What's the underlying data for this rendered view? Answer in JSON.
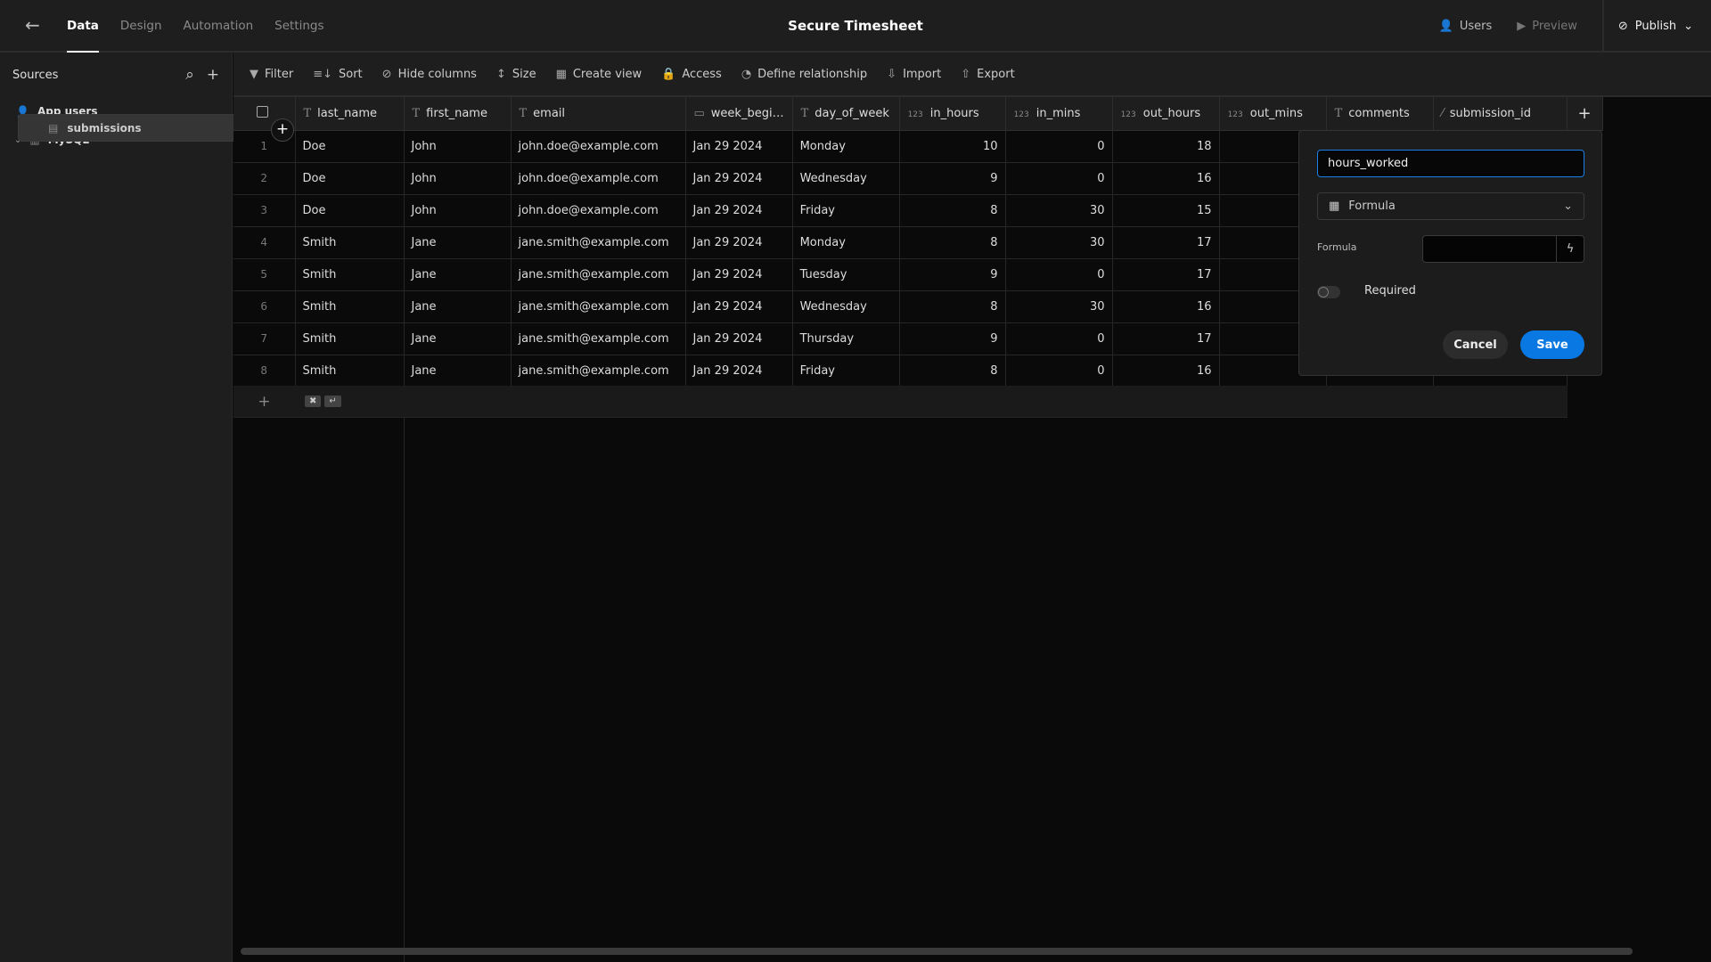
{
  "topbar": {
    "tabs": [
      "Data",
      "Design",
      "Automation",
      "Settings"
    ],
    "active_tab": "Data",
    "title": "Secure Timesheet",
    "users": "Users",
    "preview": "Preview",
    "publish": "Publish"
  },
  "sidebar": {
    "heading": "Sources",
    "items": [
      {
        "label": "App users",
        "icon": "users-icon"
      },
      {
        "label": "MySQL",
        "icon": "database-icon"
      },
      {
        "label": "submissions",
        "icon": "table-icon",
        "selected": true
      }
    ]
  },
  "toolbar": {
    "items": [
      {
        "label": "Filter",
        "icon": "▼"
      },
      {
        "label": "Sort",
        "icon": "≡↓"
      },
      {
        "label": "Hide columns",
        "icon": "⊘"
      },
      {
        "label": "Size",
        "icon": "↕"
      },
      {
        "label": "Create view",
        "icon": "▦"
      },
      {
        "label": "Access",
        "icon": "🔒"
      },
      {
        "label": "Define relationship",
        "icon": "◔"
      },
      {
        "label": "Import",
        "icon": "⇩"
      },
      {
        "label": "Export",
        "icon": "⇧"
      }
    ]
  },
  "table": {
    "columns": [
      {
        "name": "last_name",
        "type": "T"
      },
      {
        "name": "first_name",
        "type": "T"
      },
      {
        "name": "email",
        "type": "T"
      },
      {
        "name": "week_begi…",
        "type": "date"
      },
      {
        "name": "day_of_week",
        "type": "T"
      },
      {
        "name": "in_hours",
        "type": "123"
      },
      {
        "name": "in_mins",
        "type": "123"
      },
      {
        "name": "out_hours",
        "type": "123"
      },
      {
        "name": "out_mins",
        "type": "123"
      },
      {
        "name": "comments",
        "type": "T"
      },
      {
        "name": "submission_id",
        "type": "auto"
      }
    ],
    "rows": [
      [
        "1",
        "Doe",
        "John",
        "john.doe@example.com",
        "Jan 29 2024",
        "Monday",
        "10",
        "0",
        "18"
      ],
      [
        "2",
        "Doe",
        "John",
        "john.doe@example.com",
        "Jan 29 2024",
        "Wednesday",
        "9",
        "0",
        "16"
      ],
      [
        "3",
        "Doe",
        "John",
        "john.doe@example.com",
        "Jan 29 2024",
        "Friday",
        "8",
        "30",
        "15"
      ],
      [
        "4",
        "Smith",
        "Jane",
        "jane.smith@example.com",
        "Jan 29 2024",
        "Monday",
        "8",
        "30",
        "17"
      ],
      [
        "5",
        "Smith",
        "Jane",
        "jane.smith@example.com",
        "Jan 29 2024",
        "Tuesday",
        "9",
        "0",
        "17"
      ],
      [
        "6",
        "Smith",
        "Jane",
        "jane.smith@example.com",
        "Jan 29 2024",
        "Wednesday",
        "8",
        "30",
        "16"
      ],
      [
        "7",
        "Smith",
        "Jane",
        "jane.smith@example.com",
        "Jan 29 2024",
        "Thursday",
        "9",
        "0",
        "17"
      ],
      [
        "8",
        "Smith",
        "Jane",
        "jane.smith@example.com",
        "Jan 29 2024",
        "Friday",
        "8",
        "0",
        "16"
      ]
    ]
  },
  "popover": {
    "column_name": "hours_worked",
    "type": "Formula",
    "formula_label": "Formula",
    "formula_value": "",
    "required_label": "Required",
    "required": false,
    "cancel": "Cancel",
    "save": "Save"
  },
  "colors": {
    "accent": "#0a78e2",
    "background": "#0a0a0a",
    "panel": "#1e1e1e"
  }
}
